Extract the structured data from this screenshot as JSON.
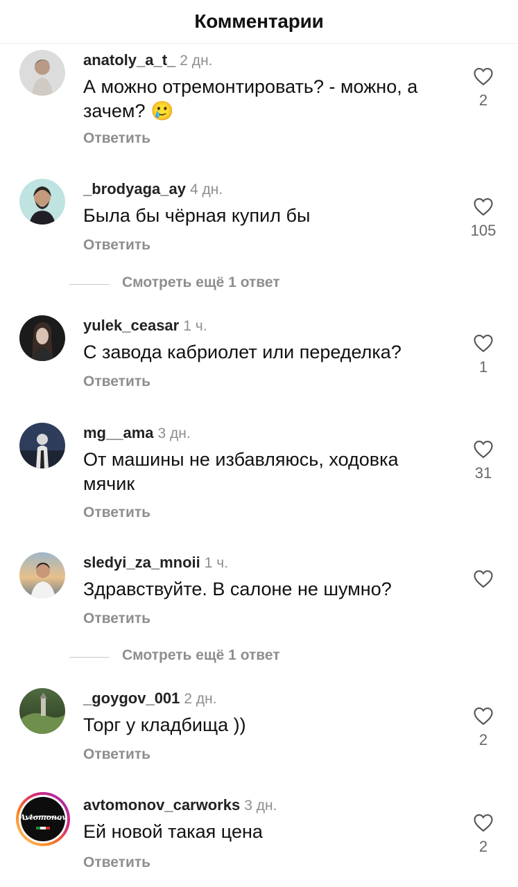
{
  "header": {
    "title": "Комментарии"
  },
  "reply_label": "Ответить",
  "like_icon": "heart-outline-icon",
  "comments": [
    {
      "username": "anatoly_a_t_",
      "time": "2 дн.",
      "text": "А можно отремонтировать? - можно, а зачем? 🥲",
      "likes": "2"
    },
    {
      "username": "_brodyaga_ay",
      "time": "4 дн.",
      "text": "Была бы чёрная купил бы",
      "likes": "105",
      "more_replies": "Смотреть ещё 1 ответ"
    },
    {
      "username": "yulek_ceasar",
      "time": "1 ч.",
      "text": "С завода кабриолет или переделка?",
      "likes": "1"
    },
    {
      "username": "mg__ama",
      "time": "3 дн.",
      "text": "От машины не избавляюсь, ходовка мячик",
      "likes": "31"
    },
    {
      "username": "sledyi_za_mnoii",
      "time": "1 ч.",
      "text": "Здравствуйте. В салоне не шумно?",
      "likes": "",
      "more_replies": "Смотреть ещё 1 ответ"
    },
    {
      "username": "_goygov_001",
      "time": "2 дн.",
      "text": "Торг у кладбища ))",
      "likes": "2"
    },
    {
      "username": "avtomonov_carworks",
      "time": "3 дн.",
      "text": "Ей новой такая цена",
      "likes": "2",
      "avatar_logo_text": "Avtomonov"
    }
  ]
}
